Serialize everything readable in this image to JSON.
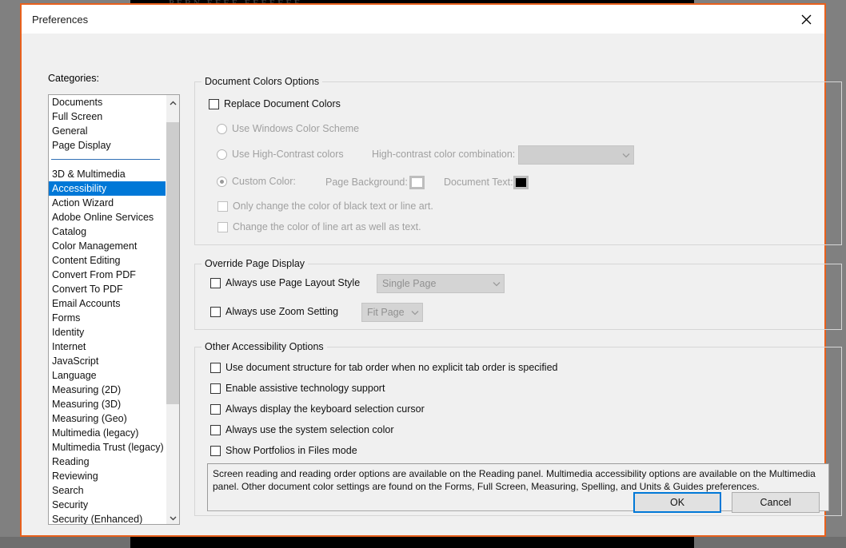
{
  "background": {
    "ghost_app_title": "PERN EEEE  EEEEEEE"
  },
  "window": {
    "title": "Preferences",
    "close_icon": "close-icon",
    "border_color": "#e8601c"
  },
  "categories": {
    "label": "Categories:",
    "selected": "Accessibility",
    "highlight_color": "#0078d7",
    "group_one": [
      "Documents",
      "Full Screen",
      "General",
      "Page Display"
    ],
    "group_two": [
      "3D & Multimedia",
      "Accessibility",
      "Action Wizard",
      "Adobe Online Services",
      "Catalog",
      "Color Management",
      "Content Editing",
      "Convert From PDF",
      "Convert To PDF",
      "Email Accounts",
      "Forms",
      "Identity",
      "Internet",
      "JavaScript",
      "Language",
      "Measuring (2D)",
      "Measuring (3D)",
      "Measuring (Geo)",
      "Multimedia (legacy)",
      "Multimedia Trust (legacy)",
      "Reading",
      "Reviewing",
      "Search",
      "Security",
      "Security (Enhanced)"
    ],
    "scroll_up_icon": "chevron-up-icon",
    "scroll_down_icon": "chevron-down-icon"
  },
  "document_colors": {
    "legend": "Document Colors Options",
    "replace_document_colors": "Replace Document Colors",
    "use_windows_color_scheme": "Use Windows Color Scheme",
    "use_high_contrast_colors": "Use High-Contrast colors",
    "high_contrast_combination_label": "High-contrast color combination:",
    "high_contrast_combination_value": "",
    "custom_color": "Custom Color:",
    "page_background_label": "Page Background:",
    "page_background_color": "#ffffff",
    "document_text_label": "Document Text:",
    "document_text_color": "#000000",
    "only_change_black_text": "Only change the color of black text or line art.",
    "change_line_art": "Change the color of line art as well as text."
  },
  "override_page_display": {
    "legend": "Override Page Display",
    "always_use_page_layout_style": "Always use Page Layout Style",
    "page_layout_value": "Single Page",
    "always_use_zoom_setting": "Always use Zoom Setting",
    "zoom_value": "Fit Page"
  },
  "other_accessibility": {
    "legend": "Other Accessibility Options",
    "options": [
      "Use document structure for tab order when no explicit tab order is specified",
      "Enable assistive technology support",
      "Always display the keyboard selection cursor",
      "Always use the system selection color",
      "Show Portfolios in Files mode"
    ]
  },
  "info_text": "Screen reading and reading order options are available on the Reading panel. Multimedia accessibility options are available on the Multimedia panel. Other document color settings are found on the Forms, Full Screen, Measuring, Spelling, and Units & Guides preferences.",
  "footer": {
    "ok_label": "OK",
    "cancel_label": "Cancel",
    "default_focus_color": "#0078d7"
  }
}
